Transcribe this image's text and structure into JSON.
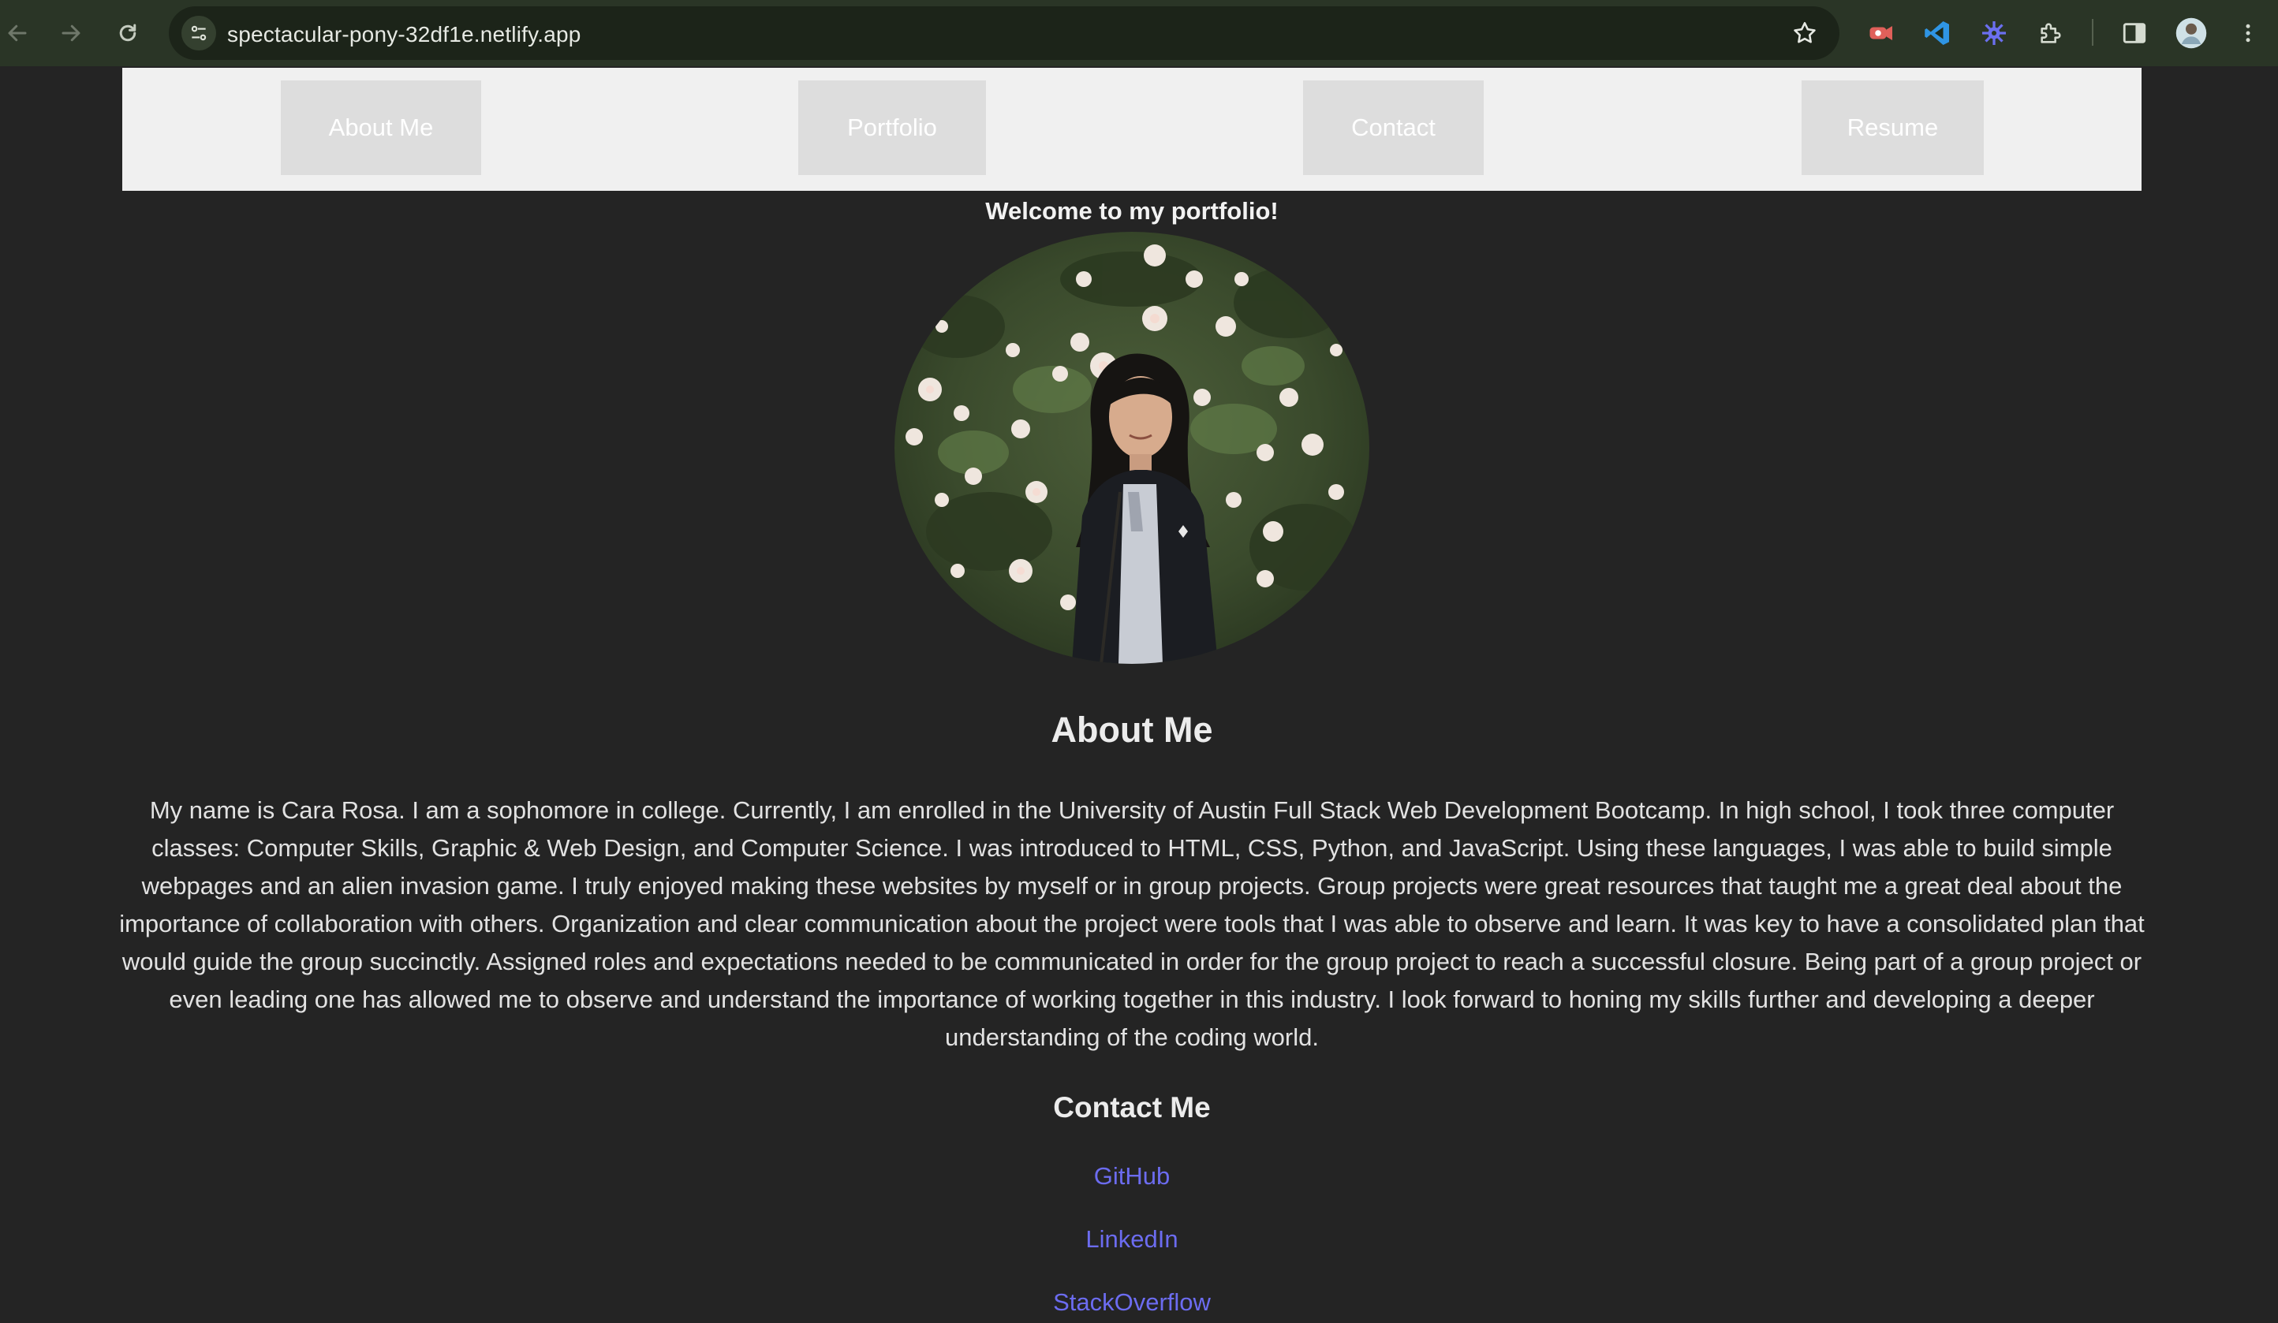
{
  "browser": {
    "url": "spectacular-pony-32df1e.netlify.app",
    "icons": [
      "back-arrow-icon",
      "forward-arrow-icon",
      "reload-icon",
      "site-info-icon",
      "bookmark-star-icon",
      "extension-red-icon",
      "vscode-icon",
      "extension-blue-gear-icon",
      "extensions-puzzle-icon",
      "side-panel-icon",
      "profile-avatar-icon",
      "menu-dots-icon"
    ]
  },
  "navbar": {
    "items": [
      {
        "label": "About Me"
      },
      {
        "label": "Portfolio"
      },
      {
        "label": "Contact"
      },
      {
        "label": "Resume"
      }
    ]
  },
  "hero": {
    "welcome": "Welcome to my portfolio!"
  },
  "about": {
    "title": "About Me",
    "text": "My name is Cara Rosa. I am a sophomore in college. Currently, I am enrolled in the University of Austin Full Stack Web Development Bootcamp. In high school, I took three computer classes: Computer Skills, Graphic & Web Design, and Computer Science. I was introduced to HTML, CSS, Python, and JavaScript. Using these languages, I was able to build simple webpages and an alien invasion game. I truly enjoyed making these websites by myself or in group projects. Group projects were great resources that taught me a great deal about the importance of collaboration with others. Organization and clear communication about the project were tools that I was able to observe and learn. It was key to have a consolidated plan that would guide the group succinctly. Assigned roles and expectations needed to be communicated in order for the group project to reach a successful closure. Being part of a group project or even leading one has allowed me to observe and understand the importance of working together in this industry. I look forward to honing my skills further and developing a deeper understanding of the coding world."
  },
  "contact": {
    "title": "Contact Me",
    "links": [
      {
        "label": "GitHub"
      },
      {
        "label": "LinkedIn"
      },
      {
        "label": "StackOverflow"
      }
    ]
  },
  "colors": {
    "page_background": "#242424",
    "navbar_background": "#f0f0f0",
    "nav_button": "#dddddd",
    "link": "#6c6cf0",
    "chrome": "#2a3526"
  }
}
